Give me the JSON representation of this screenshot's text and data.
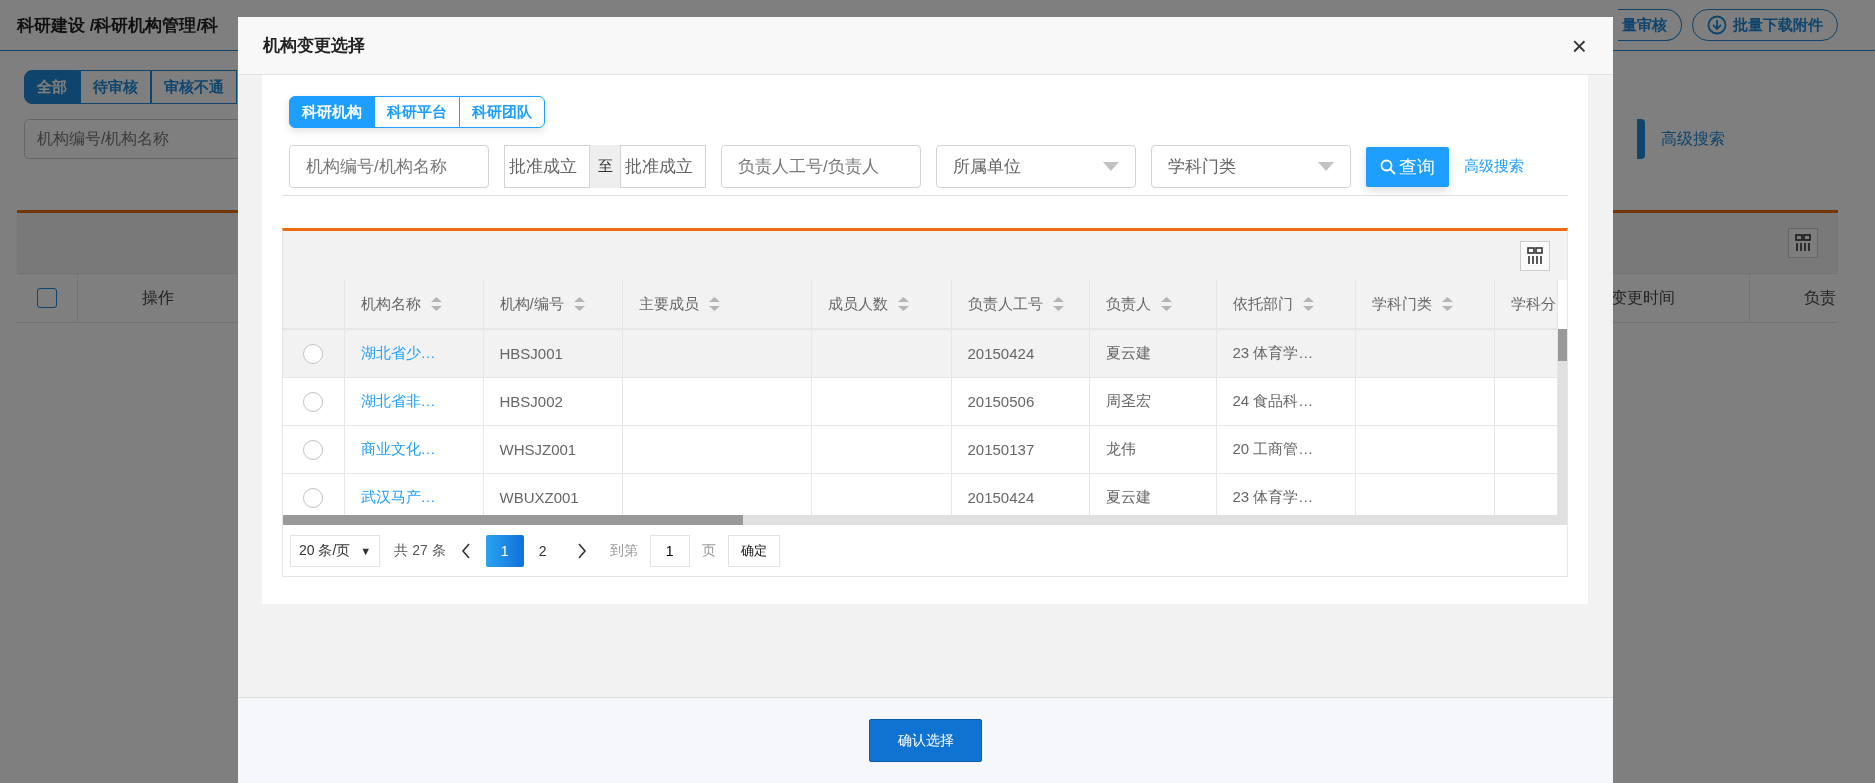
{
  "background_page": {
    "breadcrumb": "科研建设 /科研机构管理/科",
    "toolbar_buttons": [
      {
        "label": "量审核",
        "kind": "plain"
      },
      {
        "label": "批量下载附件",
        "kind": "download"
      }
    ],
    "status_tabs": [
      {
        "label": "全部",
        "selected": true
      },
      {
        "label": "待审核",
        "selected": false
      },
      {
        "label": "审核不通",
        "selected": false
      }
    ],
    "search": {
      "placeholder": "机构编号/机构名称"
    },
    "advanced_search": "高级搜索",
    "table": {
      "select_all_checked": false,
      "columns_left": [
        "操作"
      ],
      "columns_right": [
        "变更时间",
        "负责"
      ]
    }
  },
  "dialog": {
    "title": "机构变更选择",
    "close": "×",
    "type_tabs": [
      {
        "label": "科研机构",
        "selected": true
      },
      {
        "label": "科研平台",
        "selected": false
      },
      {
        "label": "科研团队",
        "selected": false
      }
    ],
    "filters": [
      {
        "kind": "text",
        "placeholder": "机构编号/机构名称"
      },
      {
        "kind": "date_range",
        "start_placeholder": "批准成立",
        "separator": "至",
        "end_placeholder": "批准成立"
      },
      {
        "kind": "text",
        "placeholder": "负责人工号/负责人"
      },
      {
        "kind": "select",
        "placeholder": "所属单位"
      },
      {
        "kind": "select",
        "placeholder": "学科门类"
      }
    ],
    "search_button": "查询",
    "advanced_search": "高级搜索",
    "table": {
      "columns": [
        {
          "label": "机构名称",
          "sortable": true
        },
        {
          "label": "机构/编号",
          "sortable": true
        },
        {
          "label": "主要成员",
          "sortable": true
        },
        {
          "label": "成员人数",
          "sortable": true
        },
        {
          "label": "负责人工号",
          "sortable": true
        },
        {
          "label": "负责人",
          "sortable": true
        },
        {
          "label": "依托部门",
          "sortable": true
        },
        {
          "label": "学科门类",
          "sortable": true
        },
        {
          "label": "学科分"
        }
      ],
      "rows": [
        {
          "selected": false,
          "highlighted": true,
          "cells": [
            "湖北省少…",
            "HBSJ001",
            null,
            null,
            "20150424",
            "夏云建",
            "23 体育学…",
            null,
            null
          ]
        },
        {
          "selected": false,
          "highlighted": false,
          "cells": [
            "湖北省非…",
            "HBSJ002",
            null,
            null,
            "20150506",
            "周圣宏",
            "24 食品科…",
            null,
            null
          ]
        },
        {
          "selected": false,
          "highlighted": false,
          "cells": [
            "商业文化…",
            "WHSJZ001",
            null,
            null,
            "20150137",
            "龙伟",
            "20 工商管…",
            null,
            null
          ]
        },
        {
          "selected": false,
          "highlighted": false,
          "cells": [
            "武汉马产…",
            "WBUXZ001",
            null,
            null,
            "20150424",
            "夏云建",
            "23 体育学…",
            null,
            null
          ]
        }
      ]
    },
    "pagination": {
      "page_size": "20 条/页",
      "page_size_caret": "▼",
      "total": "共 27 条",
      "pages": [
        {
          "label": "1",
          "selected": true
        },
        {
          "label": "2",
          "selected": false
        }
      ],
      "goto_label": "到第",
      "goto_value": "1",
      "page_unit": "页",
      "confirm": "确定"
    },
    "confirm_button": "确认选择"
  }
}
